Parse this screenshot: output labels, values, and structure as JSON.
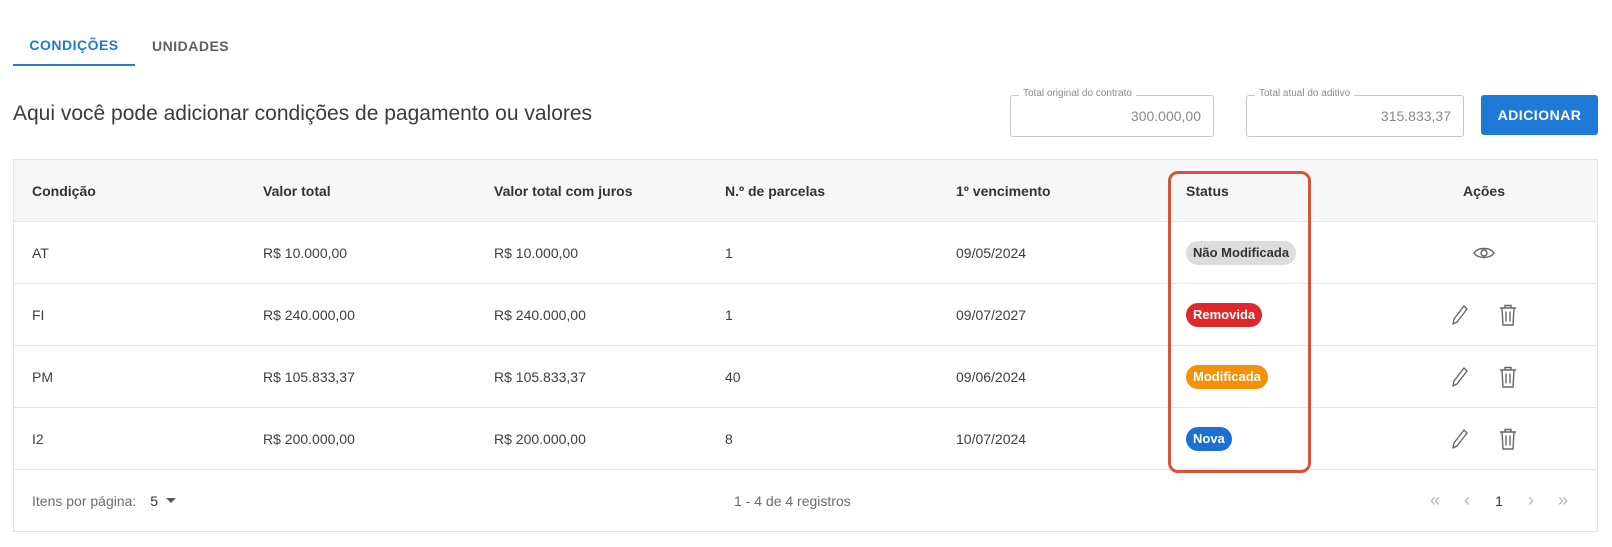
{
  "tabs": [
    {
      "label": "CONDIÇÕES",
      "active": true
    },
    {
      "label": "UNIDADES",
      "active": false
    }
  ],
  "intro_text": "Aqui você pode adicionar condições de pagamento ou valores",
  "totals": {
    "original_label": "Total original do contrato",
    "original_value": "300.000,00",
    "current_label": "Total atual do aditivo",
    "current_value": "315.833,37"
  },
  "add_button": "ADICIONAR",
  "table": {
    "headers": [
      "Condição",
      "Valor total",
      "Valor total com juros",
      "N.º de parcelas",
      "1º vencimento",
      "Status",
      "Ações"
    ],
    "rows": [
      {
        "condicao": "AT",
        "valor_total": "R$ 10.000,00",
        "valor_juros": "R$ 10.000,00",
        "parcelas": "1",
        "vencimento": "09/05/2024",
        "status": "Não Modificada",
        "status_color": "#dcdcdc"
      },
      {
        "condicao": "FI",
        "valor_total": "R$ 240.000,00",
        "valor_juros": "R$ 240.000,00",
        "parcelas": "1",
        "vencimento": "09/07/2027",
        "status": "Removida",
        "status_color": "#e0272b"
      },
      {
        "condicao": "PM",
        "valor_total": "R$ 105.833,37",
        "valor_juros": "R$ 105.833,37",
        "parcelas": "40",
        "vencimento": "09/06/2024",
        "status": "Modificada",
        "status_color": "#f5900a"
      },
      {
        "condicao": "I2",
        "valor_total": "R$ 200.000,00",
        "valor_juros": "R$ 200.000,00",
        "parcelas": "8",
        "vencimento": "10/07/2024",
        "status": "Nova",
        "status_color": "#1e6fd4"
      }
    ]
  },
  "footer": {
    "per_page_label": "Itens por página:",
    "per_page_value": "5",
    "range_text": "1 - 4 de 4 registros",
    "current_page": "1"
  },
  "icons": {
    "view": "eye-icon",
    "edit": "pencil-icon",
    "delete": "trash-icon"
  },
  "colors": {
    "accent": "#1e7ad6",
    "highlight": "#d9533a"
  }
}
